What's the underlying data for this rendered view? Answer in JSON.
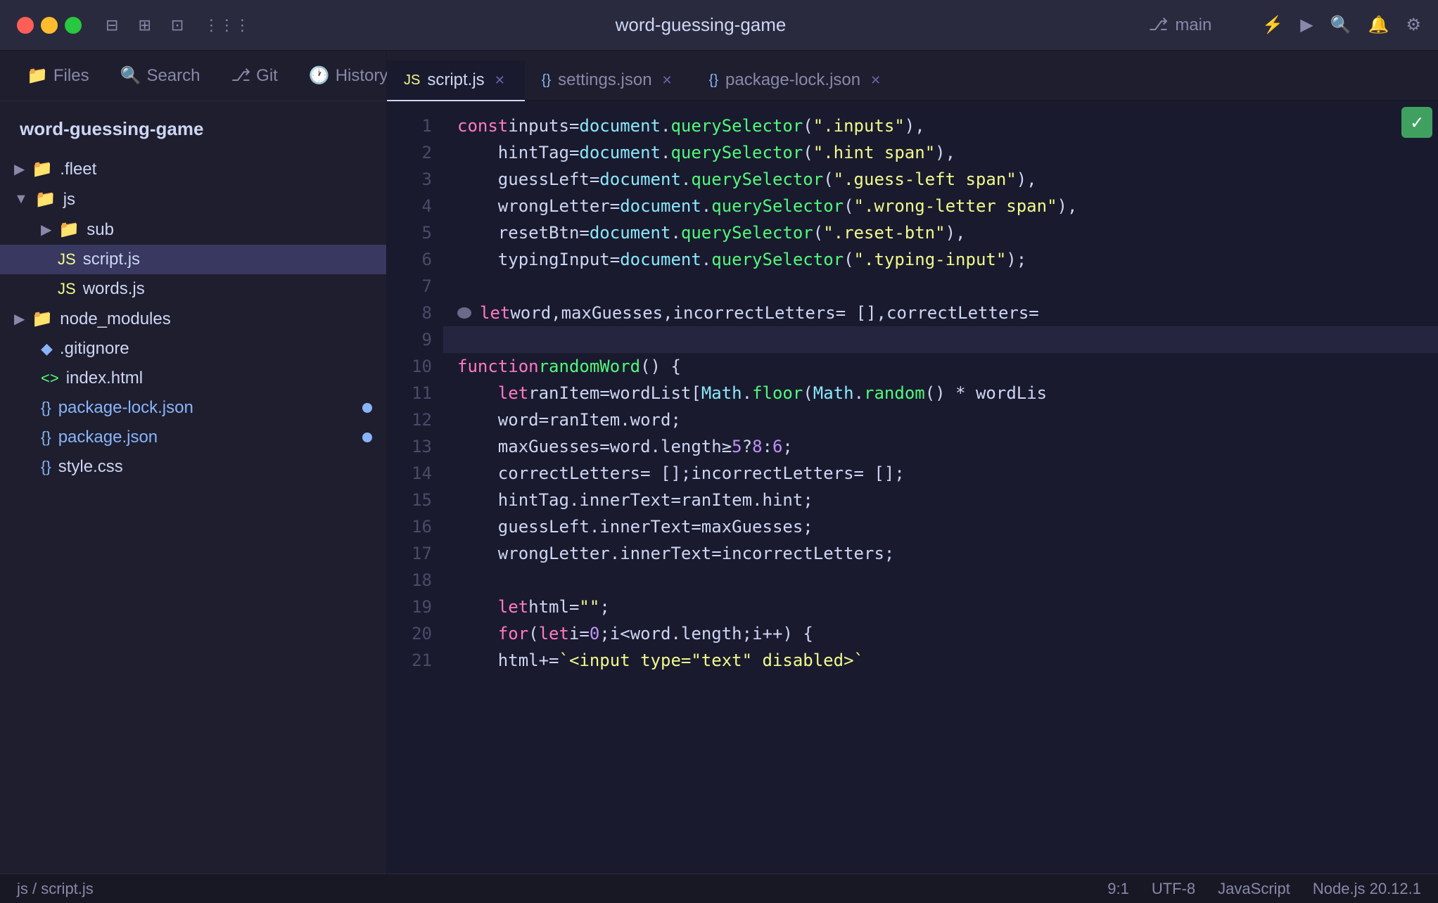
{
  "titlebar": {
    "project": "word-guessing-game",
    "branch": "main",
    "branch_icon": "⎇"
  },
  "sidebar": {
    "nav": [
      {
        "label": "Files",
        "icon": "📁",
        "name": "files"
      },
      {
        "label": "Search",
        "icon": "🔍",
        "name": "search"
      },
      {
        "label": "Git",
        "icon": "⎇",
        "name": "git"
      },
      {
        "label": "History",
        "icon": "🕐",
        "name": "history"
      }
    ],
    "project_title": "word-guessing-game",
    "files": [
      {
        "level": 1,
        "type": "folder",
        "label": ".fleet",
        "collapsed": true,
        "chevron": "▶"
      },
      {
        "level": 1,
        "type": "folder",
        "label": "js",
        "collapsed": false,
        "chevron": "▼"
      },
      {
        "level": 2,
        "type": "folder",
        "label": "sub",
        "collapsed": true,
        "chevron": "▶"
      },
      {
        "level": 2,
        "type": "file-js",
        "label": "script.js",
        "active": true
      },
      {
        "level": 2,
        "type": "file-js",
        "label": "words.js"
      },
      {
        "level": 1,
        "type": "folder",
        "label": "node_modules",
        "collapsed": true,
        "chevron": "▶"
      },
      {
        "level": 1,
        "type": "file-diamond",
        "label": ".gitignore"
      },
      {
        "level": 1,
        "type": "file-html",
        "label": "index.html"
      },
      {
        "level": 1,
        "type": "file-json",
        "label": "package-lock.json",
        "badge": true
      },
      {
        "level": 1,
        "type": "file-json",
        "label": "package.json",
        "badge": true
      },
      {
        "level": 1,
        "type": "file-css",
        "label": "style.css"
      }
    ],
    "status": "js / script.js"
  },
  "tabs": [
    {
      "label": "script.js",
      "type": "js",
      "active": true,
      "closeable": true
    },
    {
      "label": "settings.json",
      "type": "json",
      "active": false,
      "closeable": true
    },
    {
      "label": "package-lock.json",
      "type": "json",
      "active": false,
      "closeable": true
    }
  ],
  "code_lines": [
    {
      "num": 1,
      "tokens": [
        {
          "t": "kw",
          "v": "const "
        },
        {
          "t": "var-name",
          "v": "inputs"
        },
        {
          "t": "plain",
          "v": " = "
        },
        {
          "t": "obj",
          "v": "document"
        },
        {
          "t": "plain",
          "v": "."
        },
        {
          "t": "method",
          "v": "querySelector"
        },
        {
          "t": "plain",
          "v": "("
        },
        {
          "t": "str",
          "v": "\".inputs\""
        },
        {
          "t": "plain",
          "v": "),"
        }
      ]
    },
    {
      "num": 2,
      "tokens": [
        {
          "t": "plain",
          "v": "    "
        },
        {
          "t": "var-name",
          "v": "hintTag"
        },
        {
          "t": "plain",
          "v": " = "
        },
        {
          "t": "obj",
          "v": "document"
        },
        {
          "t": "plain",
          "v": "."
        },
        {
          "t": "method",
          "v": "querySelector"
        },
        {
          "t": "plain",
          "v": "("
        },
        {
          "t": "str",
          "v": "\".hint span\""
        },
        {
          "t": "plain",
          "v": "),"
        }
      ]
    },
    {
      "num": 3,
      "tokens": [
        {
          "t": "plain",
          "v": "    "
        },
        {
          "t": "var-name",
          "v": "guessLeft"
        },
        {
          "t": "plain",
          "v": " = "
        },
        {
          "t": "obj",
          "v": "document"
        },
        {
          "t": "plain",
          "v": "."
        },
        {
          "t": "method",
          "v": "querySelector"
        },
        {
          "t": "plain",
          "v": "("
        },
        {
          "t": "str",
          "v": "\".guess-left span\""
        },
        {
          "t": "plain",
          "v": "),"
        }
      ]
    },
    {
      "num": 4,
      "tokens": [
        {
          "t": "plain",
          "v": "    "
        },
        {
          "t": "var-name",
          "v": "wrongLetter"
        },
        {
          "t": "plain",
          "v": " = "
        },
        {
          "t": "obj",
          "v": "document"
        },
        {
          "t": "plain",
          "v": "."
        },
        {
          "t": "method",
          "v": "querySelector"
        },
        {
          "t": "plain",
          "v": "("
        },
        {
          "t": "str",
          "v": "\".wrong-letter span\""
        },
        {
          "t": "plain",
          "v": "),"
        }
      ]
    },
    {
      "num": 5,
      "tokens": [
        {
          "t": "plain",
          "v": "    "
        },
        {
          "t": "var-name",
          "v": "resetBtn"
        },
        {
          "t": "plain",
          "v": " = "
        },
        {
          "t": "obj",
          "v": "document"
        },
        {
          "t": "plain",
          "v": "."
        },
        {
          "t": "method",
          "v": "querySelector"
        },
        {
          "t": "plain",
          "v": "("
        },
        {
          "t": "str",
          "v": "\".reset-btn\""
        },
        {
          "t": "plain",
          "v": "),"
        }
      ]
    },
    {
      "num": 6,
      "tokens": [
        {
          "t": "plain",
          "v": "    "
        },
        {
          "t": "var-name",
          "v": "typingInput"
        },
        {
          "t": "plain",
          "v": " = "
        },
        {
          "t": "obj",
          "v": "document"
        },
        {
          "t": "plain",
          "v": "."
        },
        {
          "t": "method",
          "v": "querySelector"
        },
        {
          "t": "plain",
          "v": "("
        },
        {
          "t": "str",
          "v": "\".typing-input\""
        },
        {
          "t": "plain",
          "v": ");"
        }
      ]
    },
    {
      "num": 7,
      "tokens": []
    },
    {
      "num": 8,
      "tokens": [
        {
          "t": "gutter-dot",
          "v": ""
        },
        {
          "t": "kw",
          "v": "let "
        },
        {
          "t": "var-name",
          "v": "word"
        },
        {
          "t": "plain",
          "v": ", "
        },
        {
          "t": "var-name",
          "v": "maxGuesses"
        },
        {
          "t": "plain",
          "v": ", "
        },
        {
          "t": "var-name",
          "v": "incorrectLetters"
        },
        {
          "t": "plain",
          "v": " = [], "
        },
        {
          "t": "var-name",
          "v": "correctLetters"
        },
        {
          "t": "plain",
          "v": " ="
        }
      ]
    },
    {
      "num": 9,
      "tokens": [],
      "active": true
    },
    {
      "num": 10,
      "tokens": [
        {
          "t": "kw",
          "v": "function "
        },
        {
          "t": "fn",
          "v": "randomWord"
        },
        {
          "t": "plain",
          "v": "() {"
        }
      ]
    },
    {
      "num": 11,
      "tokens": [
        {
          "t": "plain",
          "v": "    "
        },
        {
          "t": "kw",
          "v": "let "
        },
        {
          "t": "var-name",
          "v": "ranItem"
        },
        {
          "t": "plain",
          "v": " = "
        },
        {
          "t": "var-name",
          "v": "wordList"
        },
        {
          "t": "plain",
          "v": "["
        },
        {
          "t": "obj",
          "v": "Math"
        },
        {
          "t": "plain",
          "v": "."
        },
        {
          "t": "method",
          "v": "floor"
        },
        {
          "t": "plain",
          "v": "("
        },
        {
          "t": "obj",
          "v": "Math"
        },
        {
          "t": "plain",
          "v": "."
        },
        {
          "t": "method",
          "v": "random"
        },
        {
          "t": "plain",
          "v": "() * wordLis"
        }
      ]
    },
    {
      "num": 12,
      "tokens": [
        {
          "t": "plain",
          "v": "    "
        },
        {
          "t": "var-name",
          "v": "word"
        },
        {
          "t": "plain",
          "v": " = "
        },
        {
          "t": "var-name",
          "v": "ranItem"
        },
        {
          "t": "plain",
          "v": "."
        },
        {
          "t": "var-name",
          "v": "word"
        },
        {
          "t": "plain",
          "v": ";"
        }
      ]
    },
    {
      "num": 13,
      "tokens": [
        {
          "t": "plain",
          "v": "    "
        },
        {
          "t": "var-name",
          "v": "maxGuesses"
        },
        {
          "t": "plain",
          "v": " = "
        },
        {
          "t": "var-name",
          "v": "word"
        },
        {
          "t": "plain",
          "v": "."
        },
        {
          "t": "var-name",
          "v": "length"
        },
        {
          "t": "plain",
          "v": " ≥ "
        },
        {
          "t": "num",
          "v": "5"
        },
        {
          "t": "plain",
          "v": " ? "
        },
        {
          "t": "num",
          "v": "8"
        },
        {
          "t": "plain",
          "v": " : "
        },
        {
          "t": "num",
          "v": "6"
        },
        {
          "t": "plain",
          "v": ";"
        }
      ]
    },
    {
      "num": 14,
      "tokens": [
        {
          "t": "plain",
          "v": "    "
        },
        {
          "t": "var-name",
          "v": "correctLetters"
        },
        {
          "t": "plain",
          "v": " = []; "
        },
        {
          "t": "var-name",
          "v": "incorrectLetters"
        },
        {
          "t": "plain",
          "v": " = [];"
        }
      ]
    },
    {
      "num": 15,
      "tokens": [
        {
          "t": "plain",
          "v": "    "
        },
        {
          "t": "var-name",
          "v": "hintTag"
        },
        {
          "t": "plain",
          "v": "."
        },
        {
          "t": "var-name",
          "v": "innerText"
        },
        {
          "t": "plain",
          "v": " = "
        },
        {
          "t": "var-name",
          "v": "ranItem"
        },
        {
          "t": "plain",
          "v": "."
        },
        {
          "t": "var-name",
          "v": "hint"
        },
        {
          "t": "plain",
          "v": ";"
        }
      ]
    },
    {
      "num": 16,
      "tokens": [
        {
          "t": "plain",
          "v": "    "
        },
        {
          "t": "var-name",
          "v": "guessLeft"
        },
        {
          "t": "plain",
          "v": "."
        },
        {
          "t": "var-name",
          "v": "innerText"
        },
        {
          "t": "plain",
          "v": " = "
        },
        {
          "t": "var-name",
          "v": "maxGuesses"
        },
        {
          "t": "plain",
          "v": ";"
        }
      ]
    },
    {
      "num": 17,
      "tokens": [
        {
          "t": "plain",
          "v": "    "
        },
        {
          "t": "var-name",
          "v": "wrongLetter"
        },
        {
          "t": "plain",
          "v": "."
        },
        {
          "t": "var-name",
          "v": "innerText"
        },
        {
          "t": "plain",
          "v": " = "
        },
        {
          "t": "var-name",
          "v": "incorrectLetters"
        },
        {
          "t": "plain",
          "v": ";"
        }
      ]
    },
    {
      "num": 18,
      "tokens": []
    },
    {
      "num": 19,
      "tokens": [
        {
          "t": "plain",
          "v": "    "
        },
        {
          "t": "kw",
          "v": "let "
        },
        {
          "t": "var-name",
          "v": "html"
        },
        {
          "t": "plain",
          "v": " = "
        },
        {
          "t": "str",
          "v": "\"\""
        },
        {
          "t": "plain",
          "v": ";"
        }
      ]
    },
    {
      "num": 20,
      "tokens": [
        {
          "t": "plain",
          "v": "    "
        },
        {
          "t": "kw",
          "v": "for "
        },
        {
          "t": "plain",
          "v": "("
        },
        {
          "t": "kw",
          "v": "let "
        },
        {
          "t": "var-name",
          "v": "i"
        },
        {
          "t": "plain",
          "v": " = "
        },
        {
          "t": "num",
          "v": "0"
        },
        {
          "t": "plain",
          "v": "; "
        },
        {
          "t": "var-name",
          "v": "i"
        },
        {
          "t": "plain",
          "v": " < "
        },
        {
          "t": "var-name",
          "v": "word"
        },
        {
          "t": "plain",
          "v": "."
        },
        {
          "t": "var-name",
          "v": "length"
        },
        {
          "t": "plain",
          "v": "; "
        },
        {
          "t": "var-name",
          "v": "i"
        },
        {
          "t": "plain",
          "v": "++) {"
        }
      ]
    },
    {
      "num": 21,
      "tokens": [
        {
          "t": "plain",
          "v": "    "
        },
        {
          "t": "var-name",
          "v": "html"
        },
        {
          "t": "plain",
          "v": " += "
        },
        {
          "t": "str",
          "v": "`<input type=\"text\" disabled>`"
        }
      ]
    }
  ],
  "editor_status": {
    "position": "9:1",
    "encoding": "UTF-8",
    "language": "JavaScript",
    "runtime": "Node.js 20.12.1"
  }
}
